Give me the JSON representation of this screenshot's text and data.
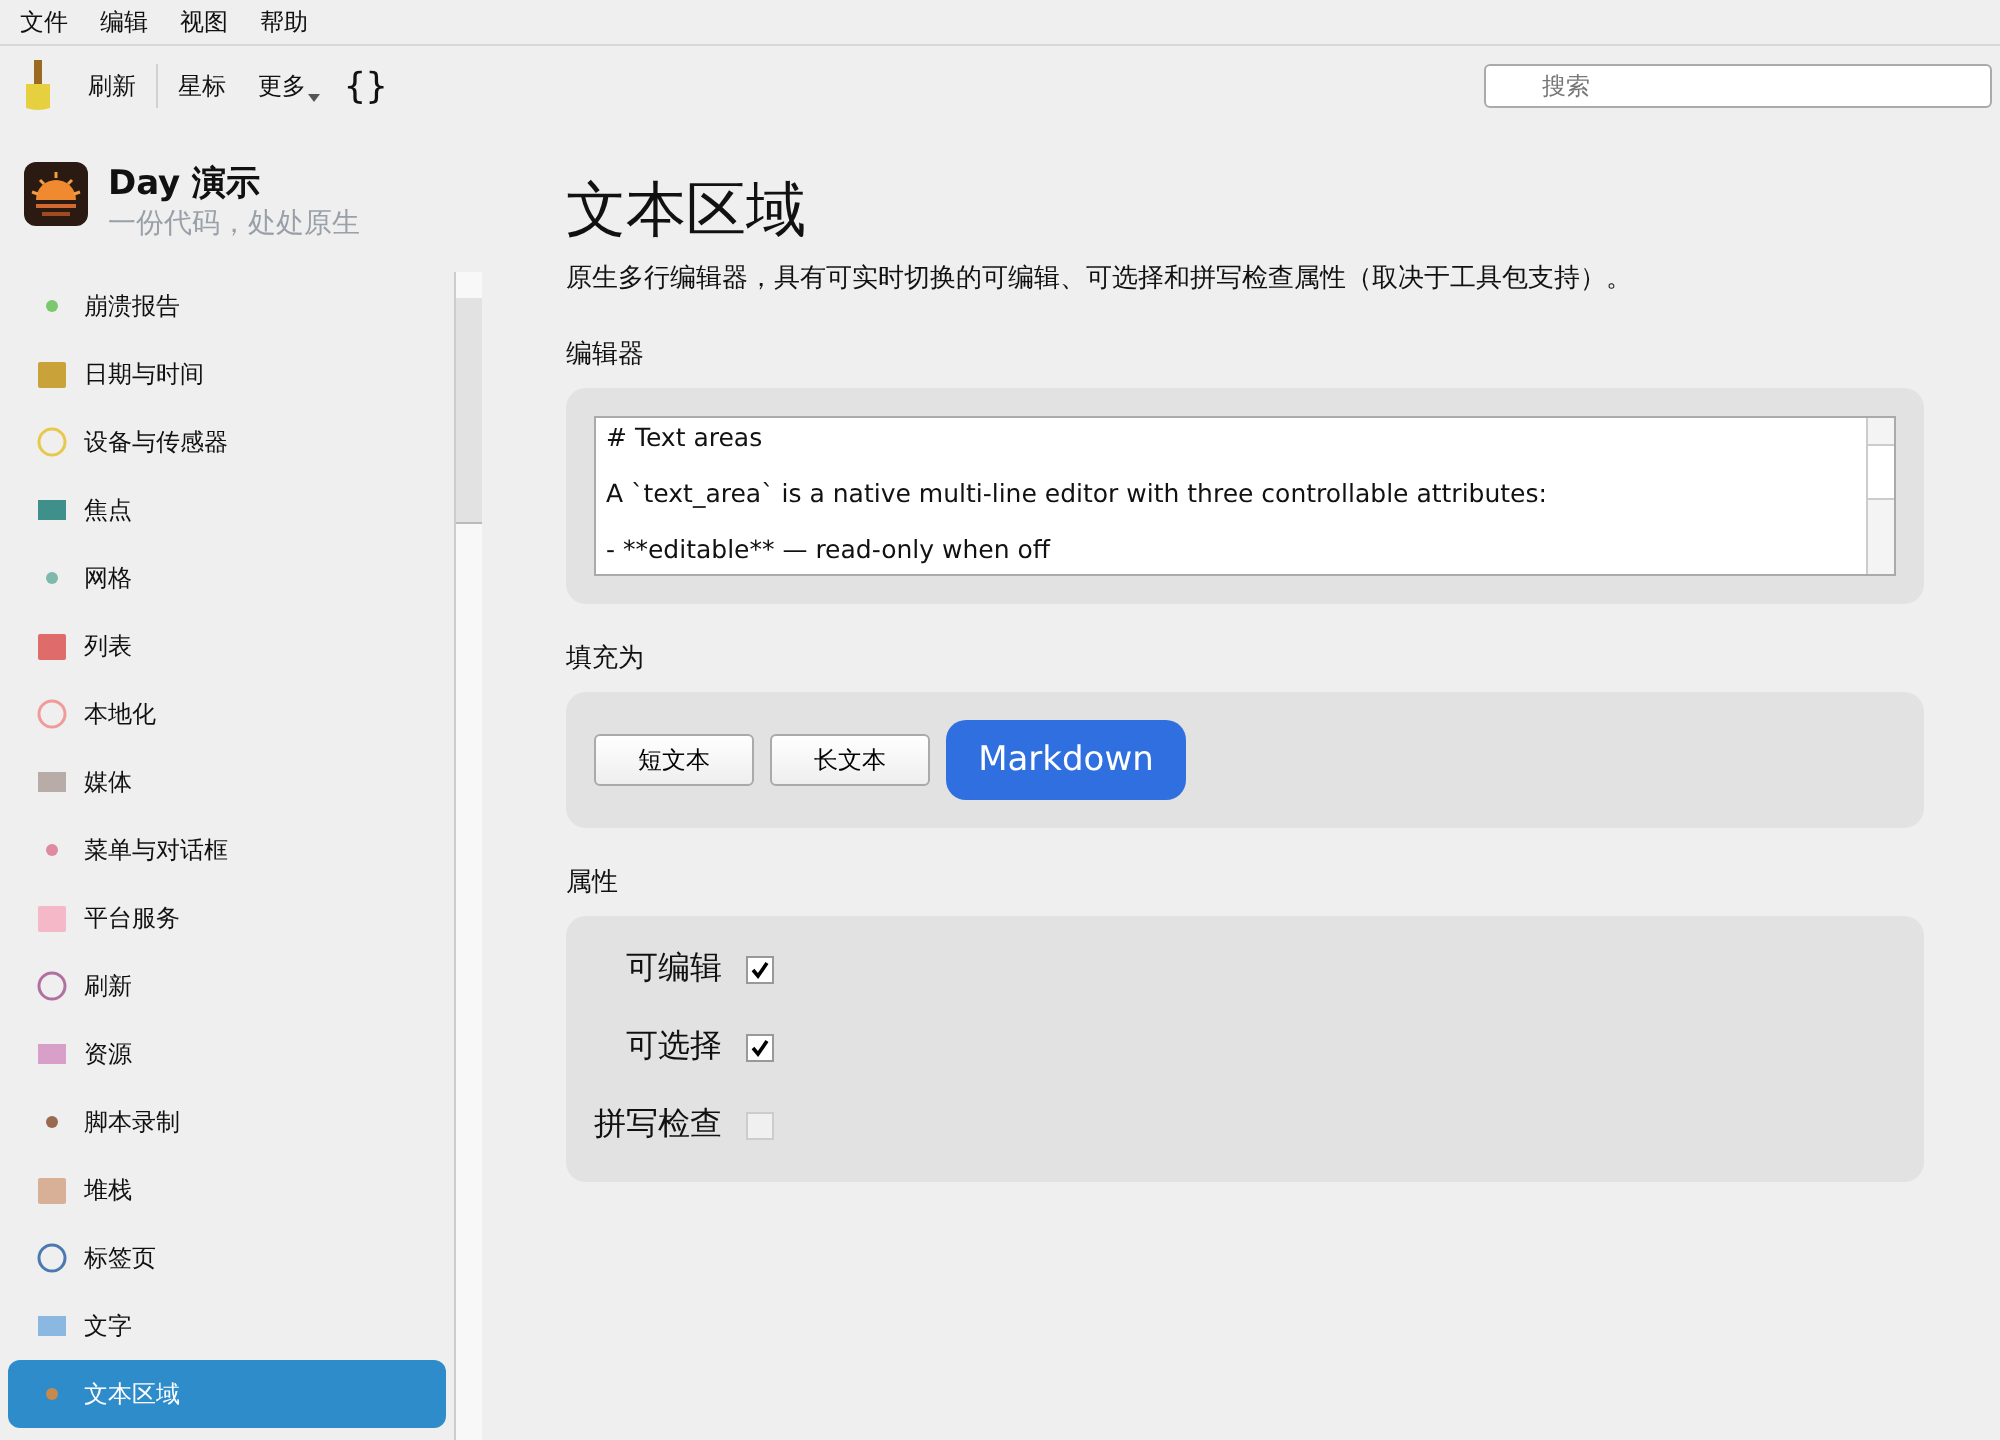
{
  "menu": [
    "文件",
    "编辑",
    "视图",
    "帮助"
  ],
  "toolbar": {
    "buttons": [
      "刷新",
      "星标",
      "更多"
    ],
    "code_symbol": "{}"
  },
  "search": {
    "placeholder": "搜索"
  },
  "app": {
    "name": "Day 演示",
    "tagline": "一份代码，处处原生"
  },
  "sidebar": {
    "items": [
      {
        "label": "崩溃报告",
        "selected": false
      },
      {
        "label": "日期与时间",
        "selected": false
      },
      {
        "label": "设备与传感器",
        "selected": false
      },
      {
        "label": "焦点",
        "selected": false
      },
      {
        "label": "网格",
        "selected": false
      },
      {
        "label": "列表",
        "selected": false
      },
      {
        "label": "本地化",
        "selected": false
      },
      {
        "label": "媒体",
        "selected": false
      },
      {
        "label": "菜单与对话框",
        "selected": false
      },
      {
        "label": "平台服务",
        "selected": false
      },
      {
        "label": "刷新",
        "selected": false
      },
      {
        "label": "资源",
        "selected": false
      },
      {
        "label": "脚本录制",
        "selected": false
      },
      {
        "label": "堆栈",
        "selected": false
      },
      {
        "label": "标签页",
        "selected": false
      },
      {
        "label": "文字",
        "selected": false
      },
      {
        "label": "文本区域",
        "selected": true
      }
    ]
  },
  "page": {
    "title": "文本区域",
    "description": "原生多行编辑器，具有可实时切换的可编辑、可选择和拼写检查属性（取决于工具包支持）。",
    "editor": {
      "heading": "编辑器",
      "lines": [
        "# Text areas",
        "A `text_area` is a native multi-line editor with three controllable attributes:",
        "- **editable** — read-only when off"
      ]
    },
    "fill": {
      "heading": "填充为",
      "options": [
        {
          "label": "短文本",
          "selected": false
        },
        {
          "label": "长文本",
          "selected": false
        },
        {
          "label": "Markdown",
          "selected": true
        }
      ]
    },
    "properties": {
      "heading": "属性",
      "items": [
        {
          "label": "可编辑",
          "checked": true
        },
        {
          "label": "可选择",
          "checked": true
        },
        {
          "label": "拼写检查",
          "checked": false
        }
      ]
    }
  }
}
